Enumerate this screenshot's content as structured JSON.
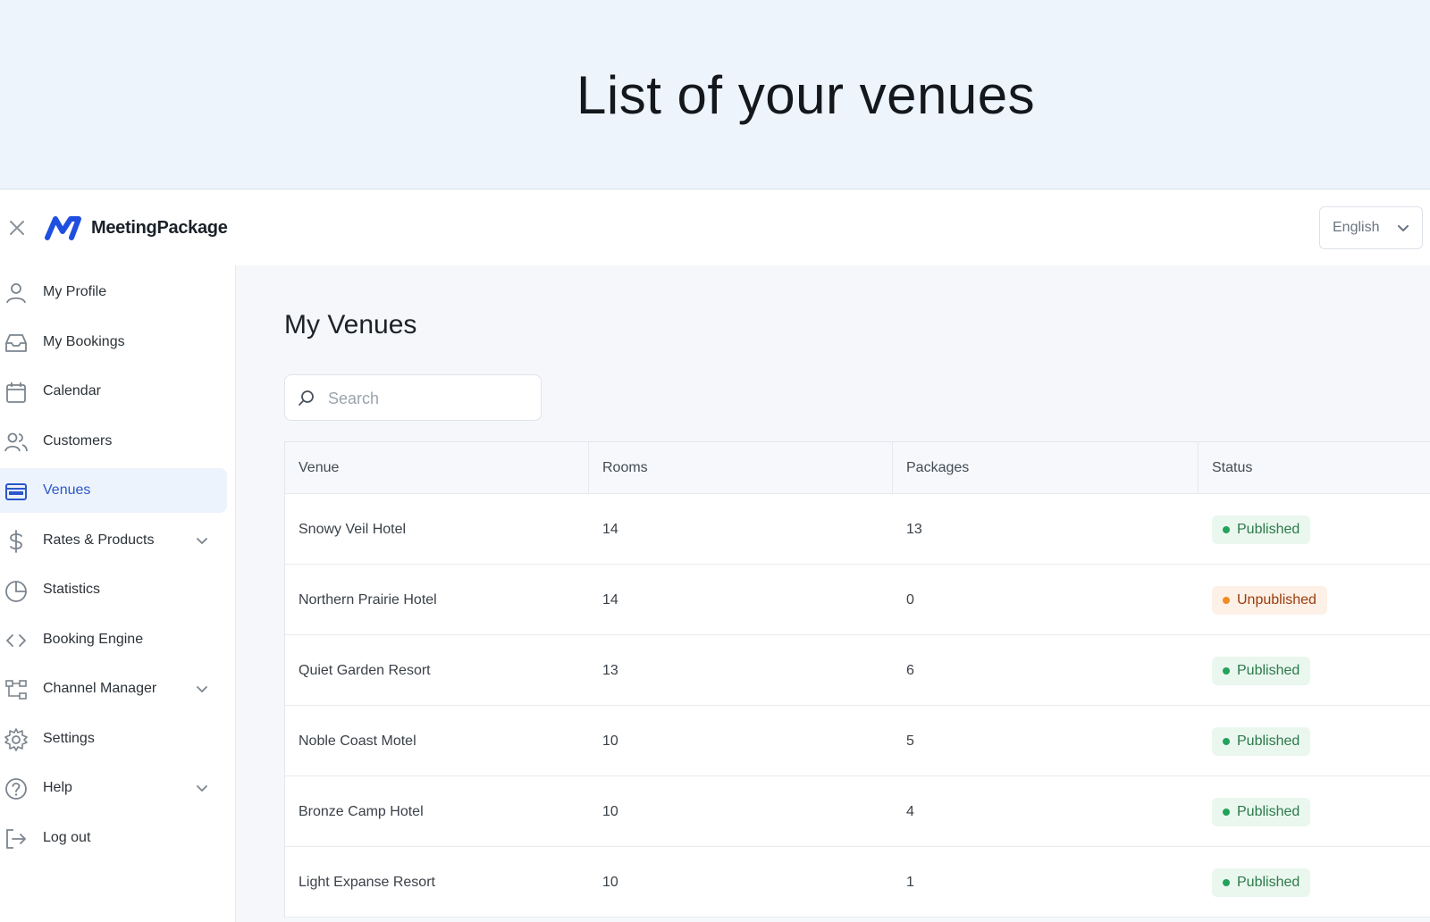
{
  "hero": {
    "title": "List of your venues"
  },
  "brand": {
    "name": "MeetingPackage",
    "color": "#1f4fe0"
  },
  "language": {
    "selected": "English"
  },
  "sidebar": {
    "items": [
      {
        "label": "My Profile",
        "icon": "user-icon",
        "expandable": false,
        "active": false
      },
      {
        "label": "My Bookings",
        "icon": "inbox-icon",
        "expandable": false,
        "active": false
      },
      {
        "label": "Calendar",
        "icon": "calendar-icon",
        "expandable": false,
        "active": false
      },
      {
        "label": "Customers",
        "icon": "users-icon",
        "expandable": false,
        "active": false
      },
      {
        "label": "Venues",
        "icon": "storefront-icon",
        "expandable": false,
        "active": true
      },
      {
        "label": "Rates & Products",
        "icon": "dollar-icon",
        "expandable": true,
        "active": false
      },
      {
        "label": "Statistics",
        "icon": "pie-chart-icon",
        "expandable": false,
        "active": false
      },
      {
        "label": "Booking Engine",
        "icon": "code-icon",
        "expandable": false,
        "active": false
      },
      {
        "label": "Channel Manager",
        "icon": "network-icon",
        "expandable": true,
        "active": false
      },
      {
        "label": "Settings",
        "icon": "gear-icon",
        "expandable": false,
        "active": false
      },
      {
        "label": "Help",
        "icon": "help-circle-icon",
        "expandable": true,
        "active": false
      },
      {
        "label": "Log out",
        "icon": "logout-icon",
        "expandable": false,
        "active": false
      }
    ]
  },
  "main": {
    "title": "My Venues",
    "search": {
      "placeholder": "Search",
      "value": ""
    },
    "table": {
      "columns": [
        "Venue",
        "Rooms",
        "Packages",
        "Status"
      ],
      "rows": [
        {
          "venue": "Snowy Veil Hotel",
          "rooms": "14",
          "packages": "13",
          "status": "Published"
        },
        {
          "venue": "Northern Prairie Hotel",
          "rooms": "14",
          "packages": "0",
          "status": "Unpublished"
        },
        {
          "venue": "Quiet Garden Resort",
          "rooms": "13",
          "packages": "6",
          "status": "Published"
        },
        {
          "venue": "Noble Coast Motel",
          "rooms": "10",
          "packages": "5",
          "status": "Published"
        },
        {
          "venue": "Bronze Camp Hotel",
          "rooms": "10",
          "packages": "4",
          "status": "Published"
        },
        {
          "venue": "Light Expanse Resort",
          "rooms": "10",
          "packages": "1",
          "status": "Published"
        }
      ]
    }
  },
  "colors": {
    "published": "#22a35a",
    "unpublished": "#f28b22",
    "active_nav": "#2a58c9"
  }
}
